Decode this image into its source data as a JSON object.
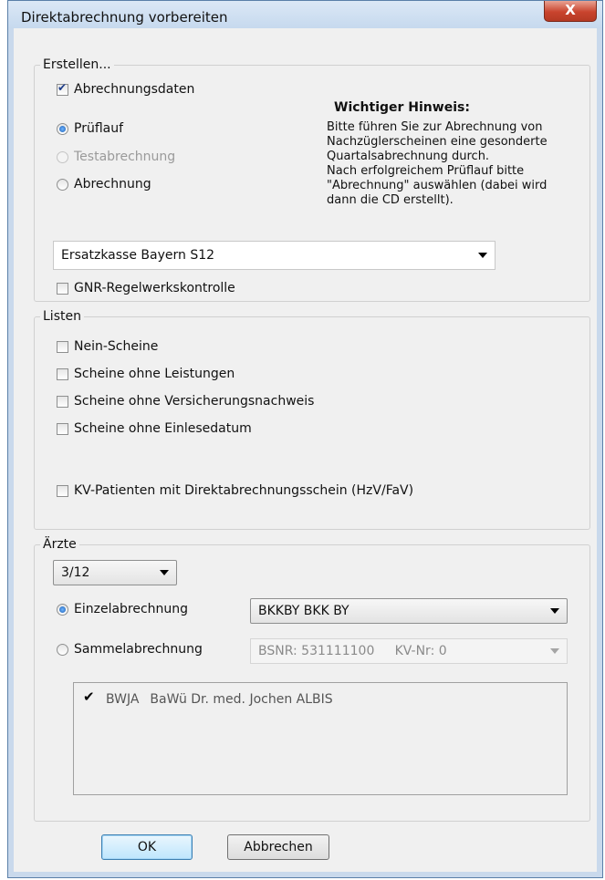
{
  "window": {
    "title": "Direktabrechnung vorbereiten",
    "close_label": "X"
  },
  "erstellen": {
    "legend": "Erstellen...",
    "abrechnungsdaten_label": "Abrechnungsdaten",
    "abrechnungsdaten_checked": true,
    "radios": [
      {
        "label": "Prüflauf",
        "checked": true,
        "enabled": true
      },
      {
        "label": "Testabrechnung",
        "checked": false,
        "enabled": false
      },
      {
        "label": "Abrechnung",
        "checked": false,
        "enabled": true
      }
    ],
    "hint_title": "Wichtiger Hinweis:",
    "hint_lines": [
      "Bitte führen Sie zur Abrechnung von",
      "Nachzüglerscheinen eine gesonderte",
      "Quartalsabrechnung durch.",
      "Nach erfolgreichem Prüflauf bitte",
      "\"Abrechnung\" auswählen (dabei wird",
      "dann die CD erstellt)."
    ],
    "kasse_select": "Ersatzkasse Bayern S12",
    "gnr_label": "GNR-Regelwerkskontrolle",
    "gnr_checked": false
  },
  "listen": {
    "legend": "Listen",
    "items": [
      "Nein-Scheine",
      "Scheine ohne Leistungen",
      "Scheine ohne Versicherungsnachweis",
      "Scheine ohne Einlesedatum"
    ],
    "kv_label": "KV-Patienten mit Direktabrechnungsschein (HzV/FaV)"
  },
  "aerzte": {
    "legend": "Ärzte",
    "quartal": "3/12",
    "einzel_label": "Einzelabrechnung",
    "einzel_checked": true,
    "einzel_select": "BKKBY  BKK BY",
    "sammel_label": "Sammelabrechnung",
    "sammel_checked": false,
    "sammel_select": "BSNR: 531111100     KV-Nr: 0",
    "doctors": [
      {
        "code": "BWJA",
        "name": "BaWü Dr. med. Jochen ALBIS",
        "checked": true
      }
    ]
  },
  "buttons": {
    "ok": "OK",
    "cancel": "Abbrechen"
  },
  "colors": {
    "radio_accent": "#1c5fb3",
    "close_button": "#c9442e",
    "default_button": "#bee6fd"
  }
}
